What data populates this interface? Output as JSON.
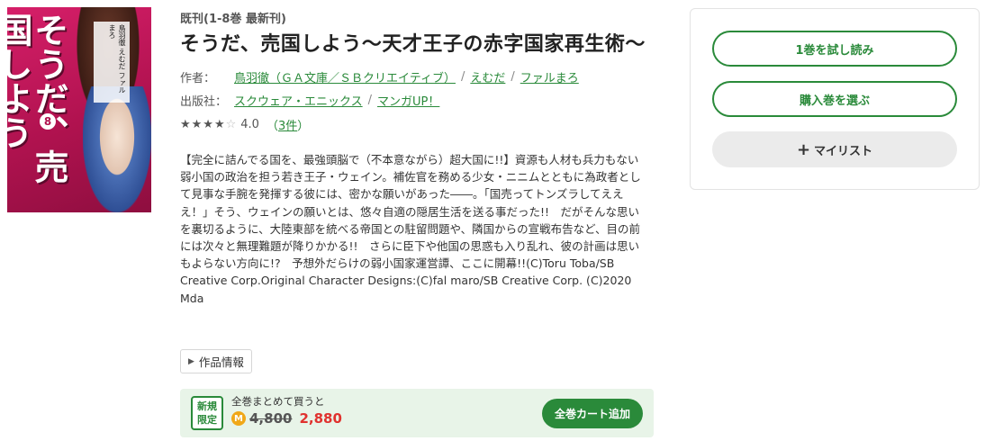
{
  "cover": {
    "title_text": "そうだ、売国しよう",
    "volume_mark": "8",
    "author_band": "鳥羽徹 えむだ ファルまろ"
  },
  "book": {
    "status": "既刊(1-8巻 最新刊)",
    "title": "そうだ、売国しよう～天才王子の赤字国家再生術～",
    "author_label": "作者：",
    "authors": [
      "鳥羽徹（ＧＡ文庫／ＳＢクリエイティブ）",
      "えむだ",
      "ファルまろ"
    ],
    "publisher_label": "出版社：",
    "publishers": [
      "スクウェア・エニックス",
      "マンガUP！"
    ],
    "separator": "/",
    "rating": {
      "stars_filled": "★★★★",
      "stars_empty": "☆",
      "score": "4.0",
      "count_open": "（",
      "count": "3件",
      "count_close": "）",
      "value": 4.0
    },
    "description": "【完全に詰んでる国を、最強頭脳で（不本意ながら）超大国に!!】資源も人材も兵力もない弱小国の政治を担う若き王子・ウェイン。補佐官を務める少女・ニニムとともに為政者として見事な手腕を発揮する彼には、密かな願いがあった――。「国売ってトンズラしてえええ！」そう、ウェインの願いとは、悠々自適の隠居生活を送る事だった!!　だがそんな思いを裏切るように、大陸東部を統べる帝国との駐留問題や、隣国からの宣戦布告など、目の前には次々と無理難題が降りかかる!!　さらに臣下や他国の思惑も入り乱れ、彼の計画は思いもよらない方向に!?　予想外だらけの弱小国家運営譚、ここに開幕!!(C)Toru Toba/SB Creative Corp.Original Character Designs:(C)fal maro/SB Creative Corp. (C)2020 Mda",
    "info_button": "作品情報"
  },
  "bulk": {
    "badge_line1": "新規",
    "badge_line2": "限定",
    "label": "全巻まとめて買うと",
    "coin": "M",
    "old_price": "4,800",
    "new_price": "2,880",
    "cart_button": "全巻カート追加"
  },
  "panel": {
    "trial_button": "1巻を試し読み",
    "select_button": "購入巻を選ぶ",
    "mylist_plus": "+",
    "mylist_button": "マイリスト"
  },
  "colors": {
    "accent": "#2a8a3a",
    "price_red": "#e0322f",
    "bulk_bg": "#e8f4e8",
    "coin": "#f0a818"
  }
}
